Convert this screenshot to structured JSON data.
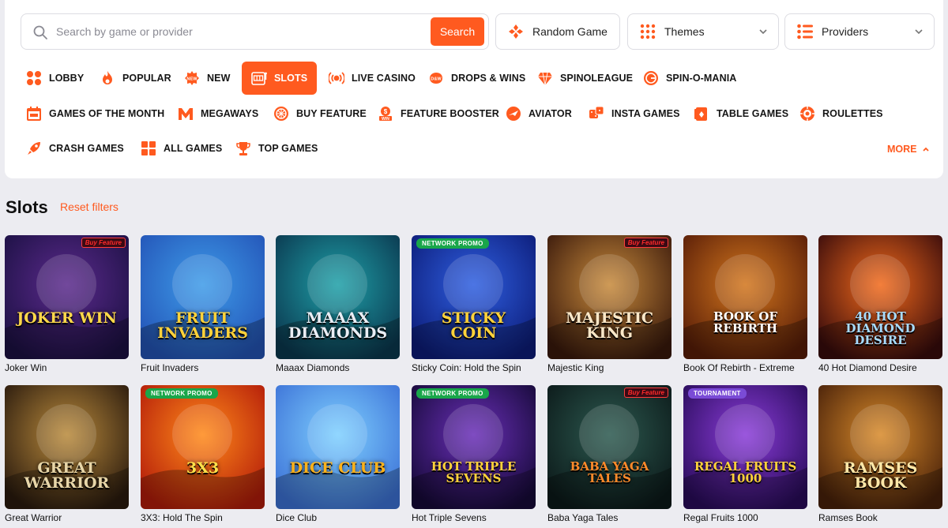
{
  "search": {
    "placeholder": "Search by game or provider",
    "button": "Search"
  },
  "toolbar": {
    "random_game": "Random Game",
    "themes": "Themes",
    "providers": "Providers"
  },
  "categories": [
    {
      "label": "LOBBY",
      "icon": "lobby-grid-icon"
    },
    {
      "label": "POPULAR",
      "icon": "flame-icon"
    },
    {
      "label": "NEW",
      "icon": "new-badge-icon"
    },
    {
      "label": "SLOTS",
      "icon": "slot-machine-icon",
      "active": true
    },
    {
      "label": "LIVE CASINO",
      "icon": "live-broadcast-icon"
    },
    {
      "label": "DROPS & WINS",
      "icon": "drops-wins-icon"
    },
    {
      "label": "SPINOLEAGUE",
      "icon": "diamond-icon"
    },
    {
      "label": "SPIN-O-MANIA",
      "icon": "spin-o-mania-icon"
    },
    {
      "label": "GAMES OF THE MONTH",
      "icon": "calendar-icon"
    },
    {
      "label": "MEGAWAYS",
      "icon": "megaways-m-icon"
    },
    {
      "label": "BUY FEATURE",
      "icon": "buy-feature-icon"
    },
    {
      "label": "FEATURE BOOSTER",
      "icon": "feature-booster-icon"
    },
    {
      "label": "AVIATOR",
      "icon": "aviator-icon"
    },
    {
      "label": "INSTA GAMES",
      "icon": "dice-icon"
    },
    {
      "label": "TABLE GAMES",
      "icon": "cards-icon"
    },
    {
      "label": "ROULETTES",
      "icon": "roulette-icon"
    },
    {
      "label": "CRASH GAMES",
      "icon": "rocket-icon"
    },
    {
      "label": "ALL GAMES",
      "icon": "all-games-grid-icon"
    },
    {
      "label": "TOP GAMES",
      "icon": "trophy-icon"
    }
  ],
  "more_label": "MORE",
  "section": {
    "title": "Slots",
    "reset": "Reset filters"
  },
  "games": [
    {
      "name": "Joker Win",
      "art": "JOKER WIN",
      "badge": "",
      "buy_feature": "Buy Feature",
      "bg1": "#5b2a8c",
      "bg2": "#1d1145",
      "fg": "#ffd84a"
    },
    {
      "name": "Fruit Invaders",
      "art": "FRUIT INVADERS",
      "badge": "",
      "buy_feature": "",
      "bg1": "#3e9be8",
      "bg2": "#2455b8",
      "fg": "#ffd23a"
    },
    {
      "name": "Maaax Diamonds",
      "art": "MAAAX DIAMONDS",
      "badge": "",
      "buy_feature": "",
      "bg1": "#1fa0a8",
      "bg2": "#0b3950",
      "fg": "#e9eef5"
    },
    {
      "name": "Sticky Coin: Hold the Spin",
      "art": "STICKY COIN",
      "badge": "NETWORK PROMO",
      "buy_feature": "",
      "bg1": "#2f5fe0",
      "bg2": "#0d1d7a",
      "fg": "#ffd23a"
    },
    {
      "name": "Majestic King",
      "art": "MAJESTIC KING",
      "badge": "",
      "buy_feature": "Buy Feature",
      "bg1": "#c78a3c",
      "bg2": "#3b1a0c",
      "fg": "#fbe8c8"
    },
    {
      "name": "Book Of Rebirth - Extreme",
      "art": "BOOK OF REBIRTH",
      "badge": "",
      "buy_feature": "",
      "bg1": "#d2761d",
      "bg2": "#5a1e08",
      "fg": "#ffffff"
    },
    {
      "name": "40 Hot Diamond Desire",
      "art": "40 HOT DIAMOND DESIRE",
      "badge": "",
      "buy_feature": "",
      "bg1": "#f26a1b",
      "bg2": "#3a0c0c",
      "fg": "#a8dcff"
    },
    {
      "name": "Great Warrior",
      "art": "GREAT WARRIOR",
      "badge": "",
      "buy_feature": "",
      "bg1": "#b98a3c",
      "bg2": "#2b1b0e",
      "fg": "#e8d6a8"
    },
    {
      "name": "3X3: Hold The Spin",
      "art": "3X3",
      "badge": "NETWORK PROMO",
      "buy_feature": "",
      "bg1": "#ff8a1a",
      "bg2": "#b41d0a",
      "fg": "#ffe04a"
    },
    {
      "name": "Dice Club",
      "art": "DICE CLUB",
      "badge": "",
      "buy_feature": "",
      "bg1": "#7fd0ff",
      "bg2": "#3e74d8",
      "fg": "#ffb21a"
    },
    {
      "name": "Hot Triple Sevens",
      "art": "HOT TRIPLE SEVENS",
      "badge": "NETWORK PROMO",
      "buy_feature": "",
      "bg1": "#6a2fb8",
      "bg2": "#170a3a",
      "fg": "#ffd23a"
    },
    {
      "name": "Baba Yaga Tales",
      "art": "BABA YAGA TALES",
      "badge": "",
      "buy_feature": "Buy Feature",
      "bg1": "#2d5a50",
      "bg2": "#0c1a1a",
      "fg": "#ff8a2a"
    },
    {
      "name": "Regal Fruits 1000",
      "art": "REGAL FRUITS 1000",
      "badge": "TOURNAMENT",
      "buy_feature": "",
      "bg1": "#8a3cd8",
      "bg2": "#2a0c5c",
      "fg": "#ffd23a"
    },
    {
      "name": "Ramses Book",
      "art": "RAMSES BOOK",
      "badge": "",
      "buy_feature": "",
      "bg1": "#d88a2a",
      "bg2": "#4a220a",
      "fg": "#ffe8a8"
    }
  ],
  "colors": {
    "accent": "#ff5a1f",
    "background": "#ececf1",
    "panel": "#ffffff"
  }
}
